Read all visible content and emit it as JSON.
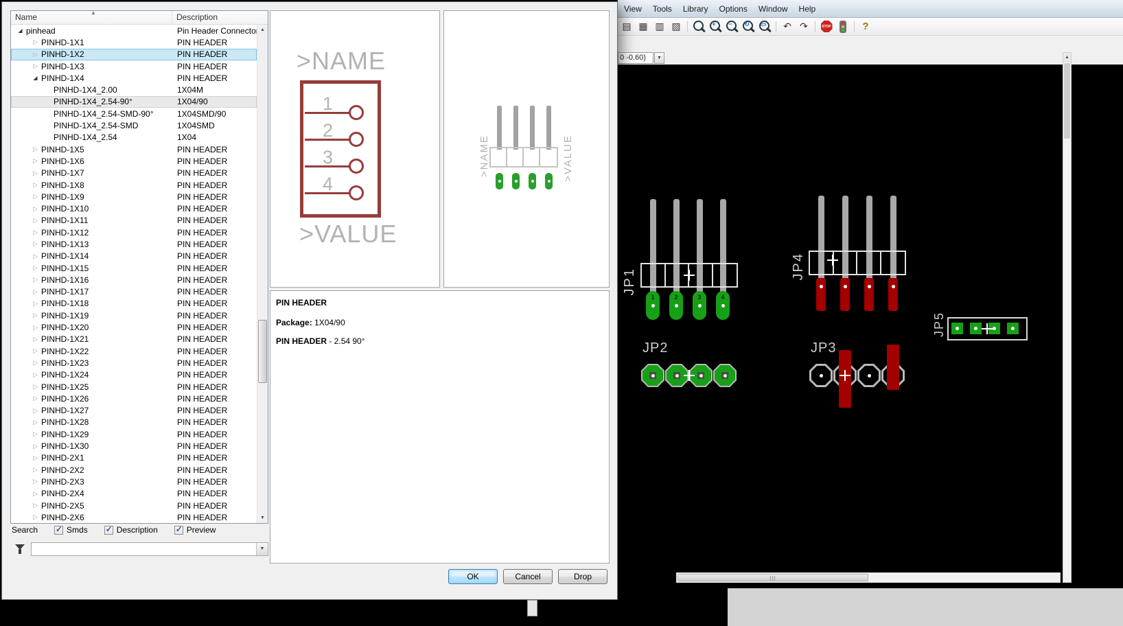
{
  "colors": {
    "selection_blue": "#cbe8f6",
    "pad_green": "#17a017",
    "copper_red": "#a30000",
    "symbol_maroon": "#963c3a",
    "silkscreen": "#e3e3e3"
  },
  "dialog": {
    "tree": {
      "columns": [
        "Name",
        "Description"
      ],
      "items": [
        {
          "name": "pinhead",
          "desc": "Pin Header Connectors",
          "cls": "lvl0 expanded"
        },
        {
          "name": "PINHD-1X1",
          "desc": "PIN HEADER",
          "cls": "lvl1 collapsed"
        },
        {
          "name": "PINHD-1X2",
          "desc": "PIN HEADER",
          "cls": "lvl1 collapsed selected"
        },
        {
          "name": "PINHD-1X3",
          "desc": "PIN HEADER",
          "cls": "lvl1 collapsed"
        },
        {
          "name": "PINHD-1X4",
          "desc": "PIN HEADER",
          "cls": "lvl1 expanded"
        },
        {
          "name": "PINHD-1X4_2.00",
          "desc": "1X04M",
          "cls": "lvl2"
        },
        {
          "name": "PINHD-1X4_2.54-90°",
          "desc": "1X04/90",
          "cls": "lvl2 subselected"
        },
        {
          "name": "PINHD-1X4_2.54-SMD-90°",
          "desc": "1X04SMD/90",
          "cls": "lvl2"
        },
        {
          "name": "PINHD-1X4_2.54-SMD",
          "desc": "1X04SMD",
          "cls": "lvl2"
        },
        {
          "name": "PINHD-1X4_2.54",
          "desc": "1X04",
          "cls": "lvl2"
        },
        {
          "name": "PINHD-1X5",
          "desc": "PIN HEADER",
          "cls": "lvl1 collapsed"
        },
        {
          "name": "PINHD-1X6",
          "desc": "PIN HEADER",
          "cls": "lvl1 collapsed"
        },
        {
          "name": "PINHD-1X7",
          "desc": "PIN HEADER",
          "cls": "lvl1 collapsed"
        },
        {
          "name": "PINHD-1X8",
          "desc": "PIN HEADER",
          "cls": "lvl1 collapsed"
        },
        {
          "name": "PINHD-1X9",
          "desc": "PIN HEADER",
          "cls": "lvl1 collapsed"
        },
        {
          "name": "PINHD-1X10",
          "desc": "PIN HEADER",
          "cls": "lvl1 collapsed"
        },
        {
          "name": "PINHD-1X11",
          "desc": "PIN HEADER",
          "cls": "lvl1 collapsed"
        },
        {
          "name": "PINHD-1X12",
          "desc": "PIN HEADER",
          "cls": "lvl1 collapsed"
        },
        {
          "name": "PINHD-1X13",
          "desc": "PIN HEADER",
          "cls": "lvl1 collapsed"
        },
        {
          "name": "PINHD-1X14",
          "desc": "PIN HEADER",
          "cls": "lvl1 collapsed"
        },
        {
          "name": "PINHD-1X15",
          "desc": "PIN HEADER",
          "cls": "lvl1 collapsed"
        },
        {
          "name": "PINHD-1X16",
          "desc": "PIN HEADER",
          "cls": "lvl1 collapsed"
        },
        {
          "name": "PINHD-1X17",
          "desc": "PIN HEADER",
          "cls": "lvl1 collapsed"
        },
        {
          "name": "PINHD-1X18",
          "desc": "PIN HEADER",
          "cls": "lvl1 collapsed"
        },
        {
          "name": "PINHD-1X19",
          "desc": "PIN HEADER",
          "cls": "lvl1 collapsed"
        },
        {
          "name": "PINHD-1X20",
          "desc": "PIN HEADER",
          "cls": "lvl1 collapsed"
        },
        {
          "name": "PINHD-1X21",
          "desc": "PIN HEADER",
          "cls": "lvl1 collapsed"
        },
        {
          "name": "PINHD-1X22",
          "desc": "PIN HEADER",
          "cls": "lvl1 collapsed"
        },
        {
          "name": "PINHD-1X23",
          "desc": "PIN HEADER",
          "cls": "lvl1 collapsed"
        },
        {
          "name": "PINHD-1X24",
          "desc": "PIN HEADER",
          "cls": "lvl1 collapsed"
        },
        {
          "name": "PINHD-1X25",
          "desc": "PIN HEADER",
          "cls": "lvl1 collapsed"
        },
        {
          "name": "PINHD-1X26",
          "desc": "PIN HEADER",
          "cls": "lvl1 collapsed"
        },
        {
          "name": "PINHD-1X27",
          "desc": "PIN HEADER",
          "cls": "lvl1 collapsed"
        },
        {
          "name": "PINHD-1X28",
          "desc": "PIN HEADER",
          "cls": "lvl1 collapsed"
        },
        {
          "name": "PINHD-1X29",
          "desc": "PIN HEADER",
          "cls": "lvl1 collapsed"
        },
        {
          "name": "PINHD-1X30",
          "desc": "PIN HEADER",
          "cls": "lvl1 collapsed"
        },
        {
          "name": "PINHD-2X1",
          "desc": "PIN HEADER",
          "cls": "lvl1 collapsed"
        },
        {
          "name": "PINHD-2X2",
          "desc": "PIN HEADER",
          "cls": "lvl1 collapsed"
        },
        {
          "name": "PINHD-2X3",
          "desc": "PIN HEADER",
          "cls": "lvl1 collapsed"
        },
        {
          "name": "PINHD-2X4",
          "desc": "PIN HEADER",
          "cls": "lvl1 collapsed"
        },
        {
          "name": "PINHD-2X5",
          "desc": "PIN HEADER",
          "cls": "lvl1 collapsed"
        },
        {
          "name": "PINHD-2X6",
          "desc": "PIN HEADER",
          "cls": "lvl1 collapsed"
        }
      ]
    },
    "search": {
      "label": "Search",
      "combo_value": "",
      "checkboxes": [
        {
          "label": "Smds",
          "cls": "checked"
        },
        {
          "label": "Description",
          "cls": "checked"
        },
        {
          "label": "Preview",
          "cls": "checked"
        }
      ]
    },
    "symbol_preview": {
      "name_label": ">NAME",
      "value_label": ">VALUE",
      "pins": [
        "1",
        "2",
        "3",
        "4"
      ]
    },
    "package_preview": {
      "name_label": ">NAME",
      "value_label": ">VALUE"
    },
    "info": {
      "title": "PIN HEADER",
      "package_label": "Package:",
      "package_value": " 1X04/90",
      "desc_bold": "PIN HEADER",
      "desc_rest": " - 2.54 90°"
    },
    "buttons": {
      "ok": "OK",
      "cancel": "Cancel",
      "drop": "Drop"
    }
  },
  "editor": {
    "menu": [
      {
        "name": "menu-view",
        "label": "View"
      },
      {
        "name": "menu-tools",
        "label": "Tools"
      },
      {
        "name": "menu-library",
        "label": "Library"
      },
      {
        "name": "menu-options",
        "label": "Options"
      },
      {
        "name": "menu-window",
        "label": "Window"
      },
      {
        "name": "menu-help",
        "label": "Help"
      }
    ],
    "toolbar": [
      {
        "name": "sheet-icon",
        "cls": "txt",
        "glyph": "▤"
      },
      {
        "name": "cam-icon",
        "cls": "txt",
        "glyph": "▦"
      },
      {
        "name": "grid-icon",
        "cls": "txt",
        "glyph": "▥"
      },
      {
        "name": "table-icon",
        "cls": "txt",
        "glyph": "▨"
      },
      {
        "name": "toolbar-separator",
        "cls": "sep",
        "glyph": ""
      },
      {
        "name": "zoom-fit-icon",
        "cls": "mag",
        "glyph": ""
      },
      {
        "name": "zoom-in-icon",
        "cls": "mag",
        "glyph": "+"
      },
      {
        "name": "zoom-out-icon",
        "cls": "mag",
        "glyph": "−"
      },
      {
        "name": "zoom-redraw-icon",
        "cls": "mag",
        "glyph": "↻"
      },
      {
        "name": "zoom-select-icon",
        "cls": "mag",
        "glyph": "▭"
      },
      {
        "name": "toolbar-separator",
        "cls": "sep",
        "glyph": ""
      },
      {
        "name": "undo-icon",
        "cls": "txt",
        "glyph": "↶"
      },
      {
        "name": "redo-icon",
        "cls": "txt",
        "glyph": "↷"
      },
      {
        "name": "toolbar-separator",
        "cls": "sep",
        "glyph": ""
      },
      {
        "name": "stop-icon",
        "cls": "stop",
        "glyph": "STOP"
      },
      {
        "name": "traffic-light-icon",
        "cls": "traffic",
        "glyph": ""
      },
      {
        "name": "toolbar-separator",
        "cls": "sep",
        "glyph": ""
      },
      {
        "name": "help-icon",
        "cls": "txt help",
        "glyph": "?"
      }
    ],
    "coord_text": "0 -0.60)",
    "board": {
      "jp1": {
        "label": "JP1",
        "pads": [
          "1",
          "2",
          "3",
          "4"
        ]
      },
      "jp2": {
        "label": "JP2"
      },
      "jp3": {
        "label": "JP3"
      },
      "jp4": {
        "label": "JP4"
      },
      "jp5": {
        "label": "JP5"
      }
    }
  }
}
